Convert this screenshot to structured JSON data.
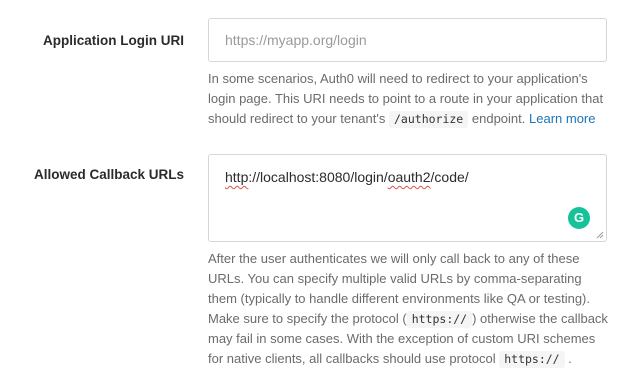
{
  "login_uri": {
    "label": "Application Login URI",
    "placeholder": "https://myapp.org/login",
    "value": "",
    "help_part1": "In some scenarios, Auth0 will need to redirect to your application's login page. This URI needs to point to a route in your application that should redirect to your tenant's",
    "help_code": "/authorize",
    "help_part2": "endpoint.",
    "help_link": "Learn more"
  },
  "callback_urls": {
    "label": "Allowed Callback URLs",
    "value_prefix": "",
    "value_http": "http",
    "value_middle": "://localhost:8080/login/",
    "value_oauth": "oauth2",
    "value_suffix": "/code/",
    "grammarly_icon_letter": "G",
    "help_part1": "After the user authenticates we will only call back to any of these URLs. You can specify multiple valid URLs by comma-separating them (typically to handle different environments like QA or testing). Make sure to specify the protocol (",
    "help_code1": "https://",
    "help_part2": ") otherwise the callback may fail in some cases. With the exception of custom URI schemes for native clients, all callbacks should use protocol",
    "help_code2": "https://",
    "help_part3": "."
  }
}
